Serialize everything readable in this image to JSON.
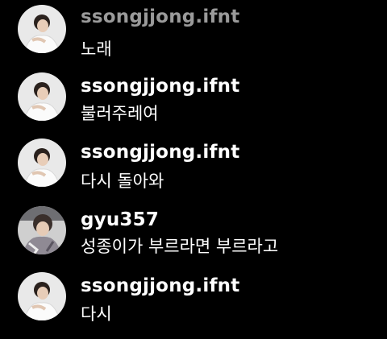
{
  "comments": [
    {
      "username": "ssongjjong.ifnt",
      "message": "노래",
      "avatar_icon": "user-avatar-person-in-white-icon"
    },
    {
      "username": "ssongjjong.ifnt",
      "message": "불러주레여",
      "avatar_icon": "user-avatar-person-in-white-icon"
    },
    {
      "username": "ssongjjong.ifnt",
      "message": "다시 돌아와",
      "avatar_icon": "user-avatar-person-in-white-icon"
    },
    {
      "username": "gyu357",
      "message": "성종이가 부르라면 부르라고",
      "avatar_icon": "user-avatar-illustrated-person-icon"
    },
    {
      "username": "ssongjjong.ifnt",
      "message": "다시",
      "avatar_icon": "user-avatar-person-in-white-icon"
    }
  ],
  "colors": {
    "background": "#000000",
    "text": "#ffffff",
    "faded_username": "#9a9a9a"
  }
}
